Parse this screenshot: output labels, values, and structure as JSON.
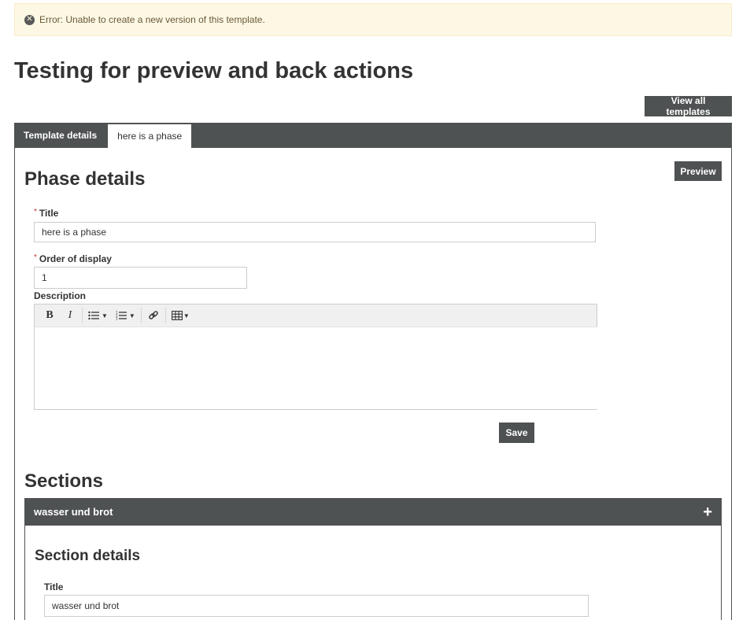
{
  "alert": {
    "icon": "error-circle-icon",
    "text": "Error: Unable to create a new version of this template."
  },
  "page": {
    "title": "Testing for preview and back actions",
    "view_all_label": "View all templates"
  },
  "tabs": [
    {
      "label": "Template details",
      "active": false
    },
    {
      "label": "here is a phase",
      "active": true
    }
  ],
  "phase": {
    "heading": "Phase details",
    "preview_label": "Preview",
    "title_label": "Title",
    "title_value": "here is a phase",
    "order_label": "Order of display",
    "order_value": "1",
    "description_label": "Description",
    "toolbar": {
      "bold": "B",
      "italic": "I",
      "icons": [
        "bold-icon",
        "italic-icon",
        "bullet-list-icon",
        "numbered-list-icon",
        "link-icon",
        "table-icon"
      ]
    },
    "save_label": "Save"
  },
  "sections": {
    "heading": "Sections",
    "items": [
      {
        "name": "wasser und brot",
        "details_heading": "Section details",
        "title_label": "Title",
        "title_value": "wasser und brot"
      }
    ]
  },
  "colors": {
    "dark": "#4f5253",
    "alert_bg": "#fcf8e3",
    "required": "#c0392b"
  }
}
